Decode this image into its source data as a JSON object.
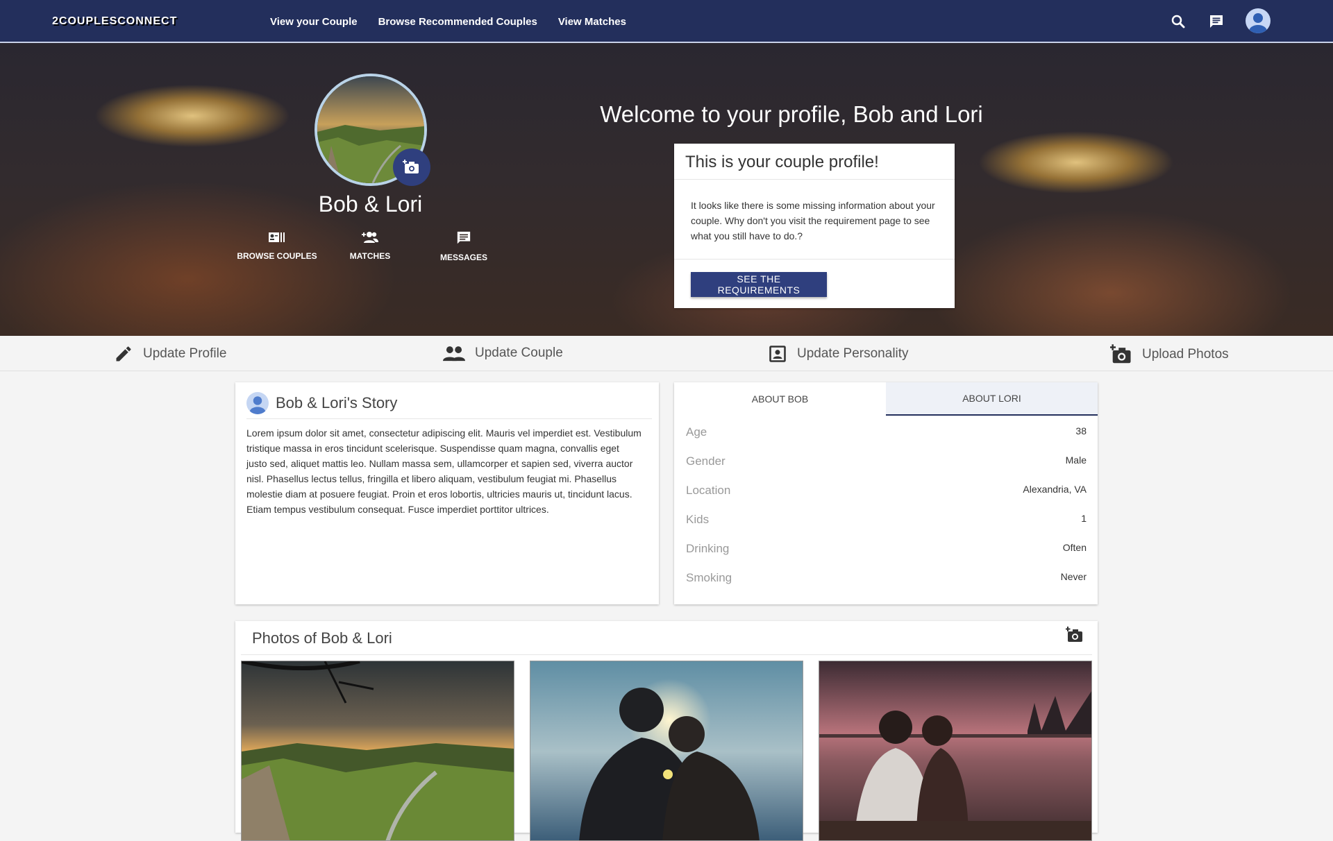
{
  "nav": {
    "brand": "2COUPLESCONNECT",
    "links": [
      "View your Couple",
      "Browse Recommended Couples",
      "View Matches"
    ],
    "icons": [
      "search-icon",
      "chat-icon",
      "account-avatar"
    ]
  },
  "hero": {
    "couple_name": "Bob & Lori",
    "welcome": "Welcome to your profile, Bob and Lori",
    "quick_links": [
      "BROWSE COUPLES",
      "MATCHES",
      "MESSAGES"
    ],
    "card": {
      "title": "This is your couple profile!",
      "body": "It looks like there is some missing information about your couple. Why don't you visit the requirement page to see what you still have to do.?",
      "button": "SEE THE REQUIREMENTS"
    }
  },
  "actions": [
    "Update Profile",
    "Update Couple",
    "Update Personality",
    "Upload Photos"
  ],
  "story": {
    "title": "Bob & Lori's Story",
    "text": "Lorem ipsum dolor sit amet, consectetur adipiscing elit. Mauris vel imperdiet est. Vestibulum tristique massa in eros tincidunt scelerisque. Suspendisse quam magna, convallis eget justo sed, aliquet mattis leo. Nullam massa sem, ullamcorper et sapien sed, viverra auctor nisl. Phasellus lectus tellus, fringilla et libero aliquam, vestibulum feugiat mi. Phasellus molestie diam at posuere feugiat. Proin et eros lobortis, ultricies mauris ut, tincidunt lacus. Etiam tempus vestibulum consequat. Fusce imperdiet porttitor ultrices."
  },
  "about": {
    "tabs": [
      "ABOUT BOB",
      "ABOUT LORI"
    ],
    "selected_tab": "ABOUT LORI",
    "rows": [
      {
        "label": "Age",
        "value": "38"
      },
      {
        "label": "Gender",
        "value": "Male"
      },
      {
        "label": "Location",
        "value": "Alexandria, VA"
      },
      {
        "label": "Kids",
        "value": "1"
      },
      {
        "label": "Drinking",
        "value": "Often"
      },
      {
        "label": "Smoking",
        "value": "Never"
      }
    ]
  },
  "photos": {
    "title": "Photos of Bob & Lori"
  },
  "colors": {
    "nav_bg": "#232f5c",
    "accent": "#2f3f7e",
    "page_bg": "#f4f4f4"
  }
}
